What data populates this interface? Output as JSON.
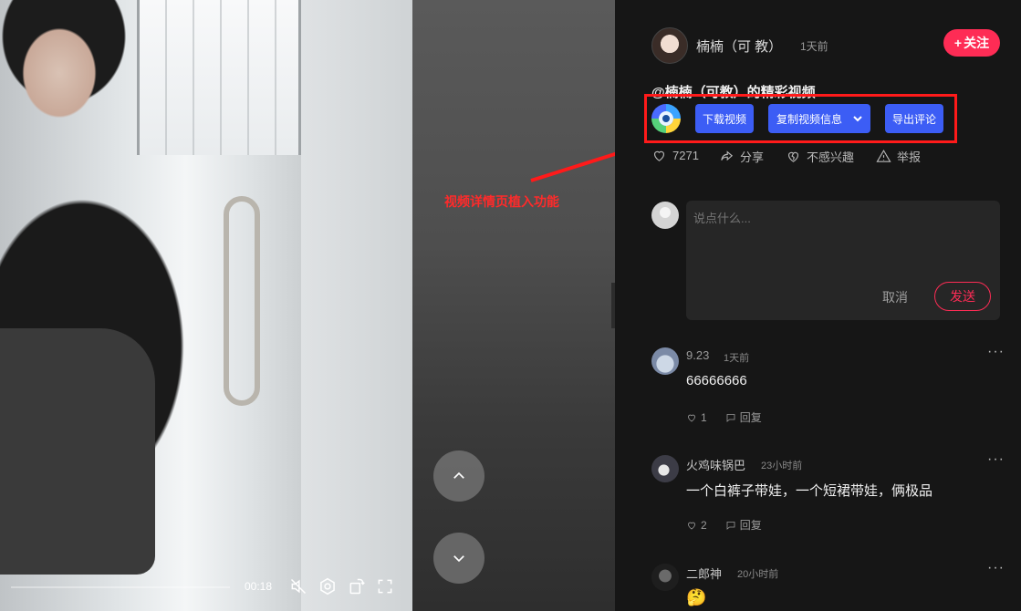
{
  "video": {
    "time": "00:18"
  },
  "annotation": {
    "text": "视频详情页植入功能",
    "color": "#ff1a1a"
  },
  "author": {
    "name": "楠楠（可 教）",
    "time": "1天前",
    "follow_label": "关注"
  },
  "post": {
    "description": "@楠楠（可教）的精彩视频"
  },
  "toolbar": {
    "download_label": "下载视频",
    "copy_info_label": "复制视频信息",
    "export_comments_label": "导出评论"
  },
  "actions": {
    "likes": "7271",
    "share": "分享",
    "not_interested": "不感兴趣",
    "report": "举报"
  },
  "comment_input": {
    "placeholder": "说点什么...",
    "cancel_label": "取消",
    "send_label": "发送"
  },
  "comments": [
    {
      "name": "9.23",
      "time": "1天前",
      "text": "66666666",
      "likes": "1",
      "reply_label": "回复"
    },
    {
      "name": "火鸡味锅巴",
      "time": "23小时前",
      "text": "一个白裤子带娃，一个短裙带娃，俩极品",
      "likes": "2",
      "reply_label": "回复"
    },
    {
      "name": "二郎神",
      "time": "20小时前",
      "text": "🤔",
      "likes": "",
      "reply_label": ""
    }
  ],
  "colors": {
    "accent": "#fe2c55",
    "tool_button": "#3c5df5",
    "background": "#161616"
  }
}
